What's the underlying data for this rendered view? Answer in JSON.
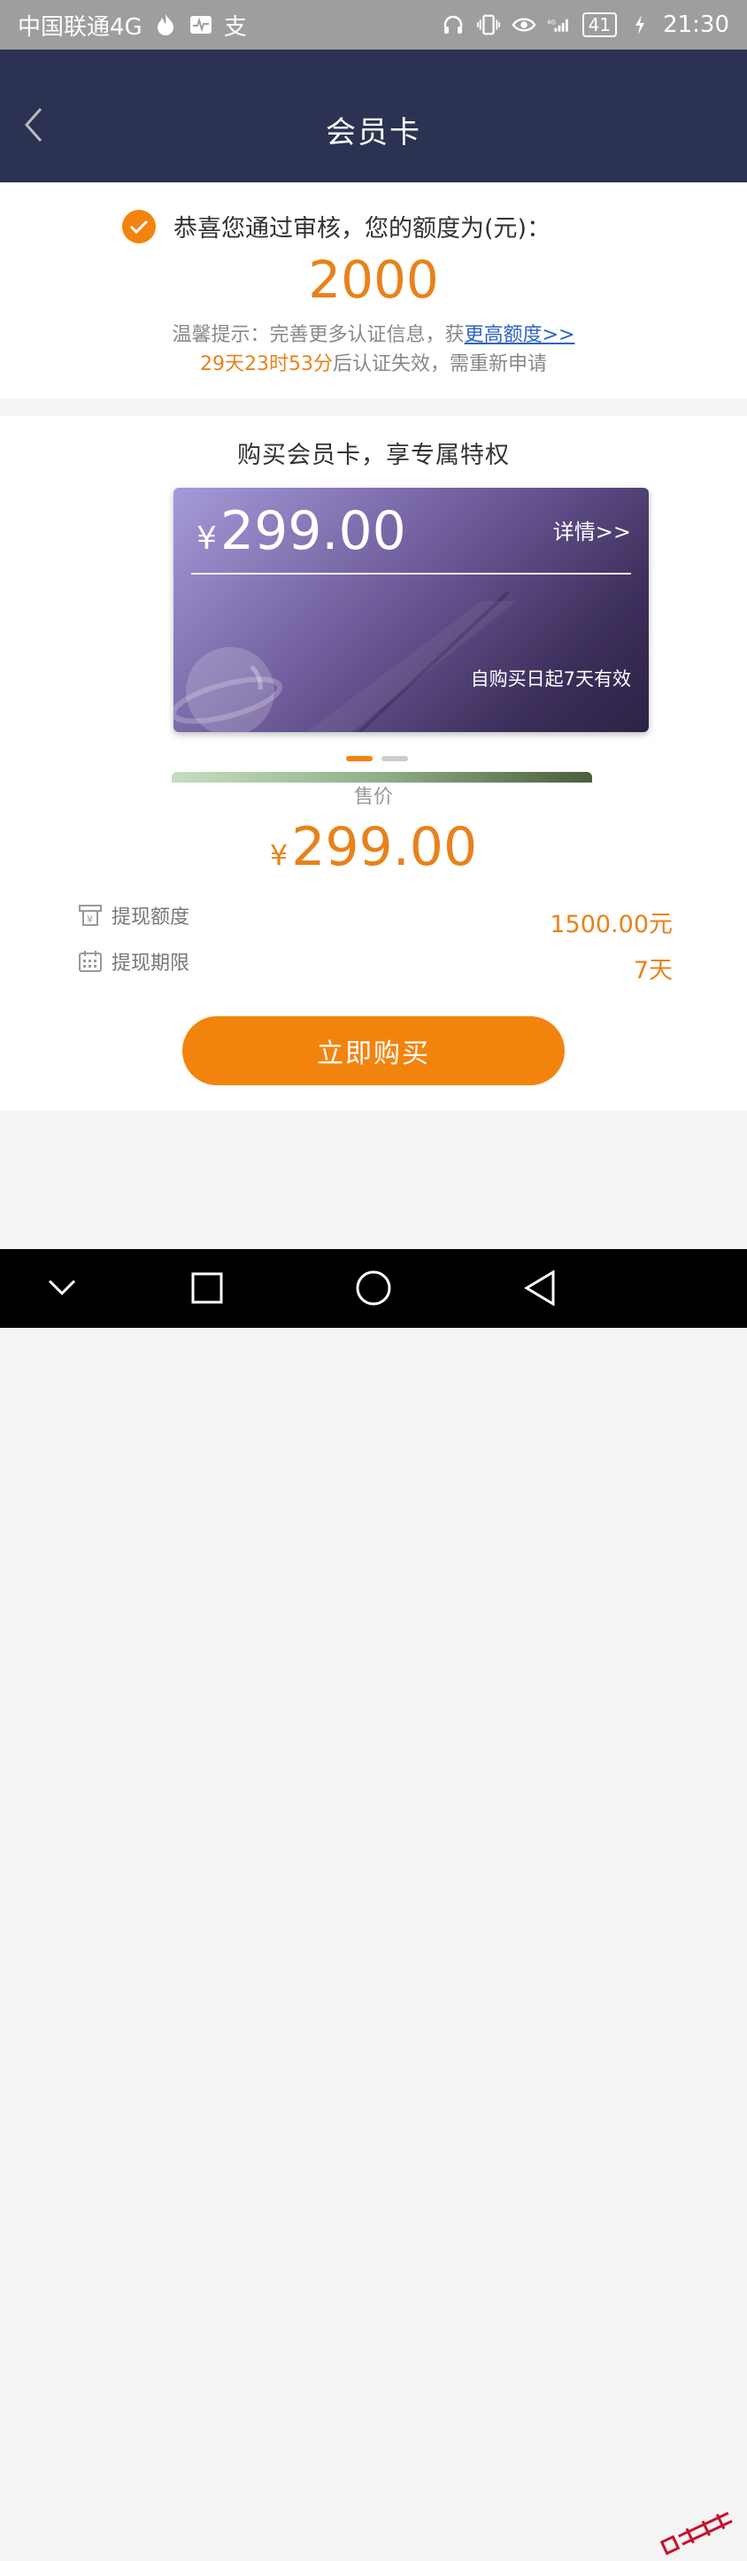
{
  "status_bar": {
    "carrier": "中国联通4G",
    "alipay_glyph": "支",
    "battery": "41",
    "time": "21:30"
  },
  "header": {
    "title": "会员卡"
  },
  "approval": {
    "message": "恭喜您通过审核，您的额度为(元)：",
    "amount": "2000",
    "tip_prefix": "温馨提示：完善更多认证信息，获",
    "tip_link": "更高额度>>",
    "countdown": "29天23时53分",
    "expiry_suffix": "后认证失效，需重新申请"
  },
  "purchase": {
    "title": "购买会员卡，享专属特权",
    "card": {
      "currency": "¥",
      "price": "299.00",
      "detail_link": "详情>>",
      "validity": "自购买日起7天有效"
    },
    "carousel": {
      "total": 2,
      "active_index": 0
    },
    "sale_label": "售价",
    "sale_currency": "¥",
    "sale_price": "299.00",
    "info": [
      {
        "label": "提现额度",
        "value": "1500.00元",
        "icon": "atm-icon"
      },
      {
        "label": "提现期限",
        "value": "7天",
        "icon": "calendar-icon"
      }
    ],
    "buy_button": "立即购买"
  },
  "colors": {
    "accent": "#f2840e",
    "header_bg": "#2c3352",
    "link": "#2f63c2"
  }
}
